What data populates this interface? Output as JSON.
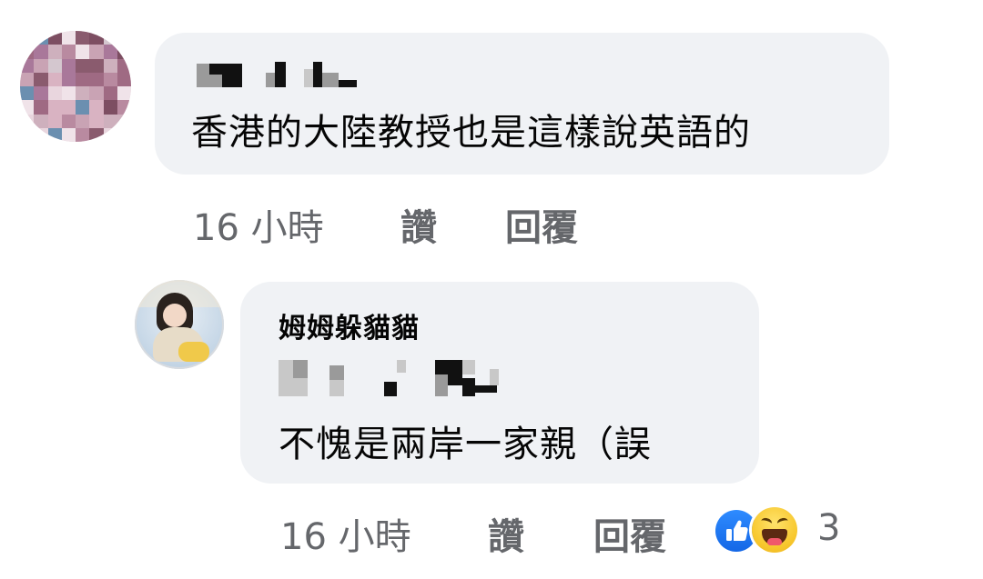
{
  "comment_1": {
    "text": "香港的大陸教授也是這樣說英語的",
    "time": "16 小時",
    "like_label": "讚",
    "reply_label": "回覆"
  },
  "comment_2": {
    "author": "姆姆躲貓貓",
    "text": "不愧是兩岸一家親（誤",
    "time": "16 小時",
    "like_label": "讚",
    "reply_label": "回覆",
    "reaction_count": "3",
    "reactions": [
      "like-icon",
      "haha-icon"
    ]
  },
  "colors": {
    "bubble": "#f0f2f5",
    "text": "#050505",
    "meta": "#65676b",
    "like_blue": "#1877f2",
    "haha_yellow": "#f7c72d"
  }
}
